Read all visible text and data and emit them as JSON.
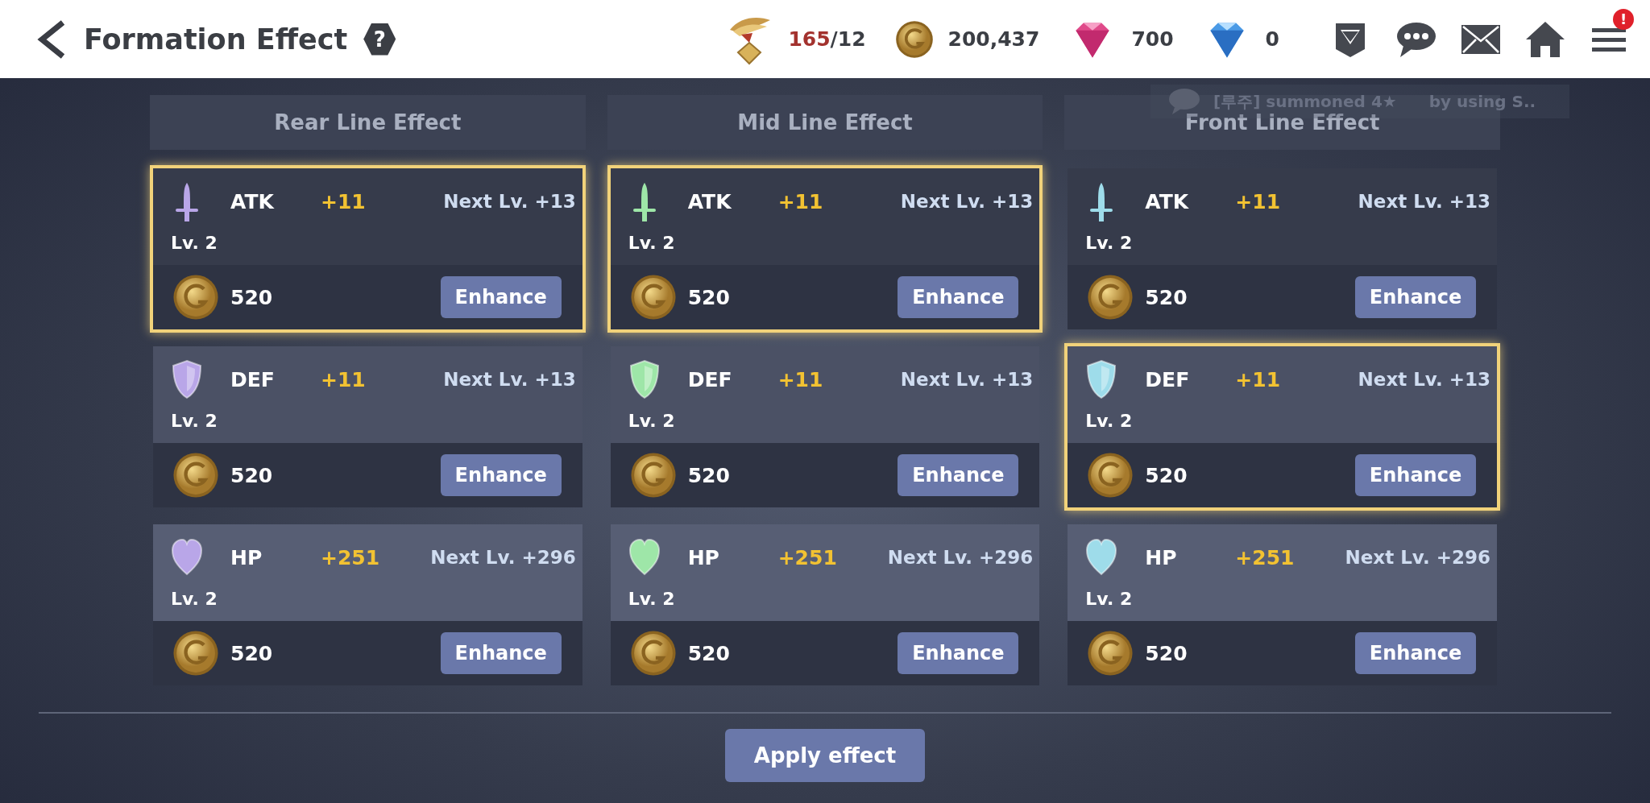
{
  "header": {
    "title": "Formation Effect",
    "help": "?"
  },
  "resources": [
    {
      "kind": "medal",
      "value": "165",
      "suffix": "/12"
    },
    {
      "kind": "coin",
      "value": "200,437"
    },
    {
      "kind": "pink-gem",
      "value": "700"
    },
    {
      "kind": "blue-gem",
      "value": "0"
    }
  ],
  "toolbar": [
    {
      "kind": "shield"
    },
    {
      "kind": "chat"
    },
    {
      "kind": "mail"
    },
    {
      "kind": "home"
    },
    {
      "kind": "menu",
      "badge": "!"
    }
  ],
  "toast": {
    "prefix": "[루주] summoned 4★",
    "suffix": "by using S.."
  },
  "columns": [
    {
      "title": "Rear Line Effect",
      "color": "#b9a6e8",
      "cards": [
        {
          "kind": "sword",
          "stat": "ATK",
          "value": "+11",
          "next": "Next Lv. +13",
          "level": "Lv. 2",
          "cost": "520",
          "button": "Enhance",
          "selected": true
        },
        {
          "kind": "shield",
          "stat": "DEF",
          "value": "+11",
          "next": "Next Lv. +13",
          "level": "Lv. 2",
          "cost": "520",
          "button": "Enhance",
          "selected": false
        },
        {
          "kind": "heart",
          "stat": "HP",
          "value": "+251",
          "next": "Next Lv. +296",
          "level": "Lv. 2",
          "cost": "520",
          "button": "Enhance",
          "selected": false
        }
      ]
    },
    {
      "title": "Mid Line Effect",
      "color": "#9ee6a8",
      "cards": [
        {
          "kind": "sword",
          "stat": "ATK",
          "value": "+11",
          "next": "Next Lv. +13",
          "level": "Lv. 2",
          "cost": "520",
          "button": "Enhance",
          "selected": true
        },
        {
          "kind": "shield",
          "stat": "DEF",
          "value": "+11",
          "next": "Next Lv. +13",
          "level": "Lv. 2",
          "cost": "520",
          "button": "Enhance",
          "selected": false
        },
        {
          "kind": "heart",
          "stat": "HP",
          "value": "+251",
          "next": "Next Lv. +296",
          "level": "Lv. 2",
          "cost": "520",
          "button": "Enhance",
          "selected": false
        }
      ]
    },
    {
      "title": "Front Line Effect",
      "color": "#9edcea",
      "cards": [
        {
          "kind": "sword",
          "stat": "ATK",
          "value": "+11",
          "next": "Next Lv. +13",
          "level": "Lv. 2",
          "cost": "520",
          "button": "Enhance",
          "selected": false
        },
        {
          "kind": "shield",
          "stat": "DEF",
          "value": "+11",
          "next": "Next Lv. +13",
          "level": "Lv. 2",
          "cost": "520",
          "button": "Enhance",
          "selected": true
        },
        {
          "kind": "heart",
          "stat": "HP",
          "value": "+251",
          "next": "Next Lv. +296",
          "level": "Lv. 2",
          "cost": "520",
          "button": "Enhance",
          "selected": false
        }
      ]
    }
  ],
  "apply_button": "Apply effect"
}
